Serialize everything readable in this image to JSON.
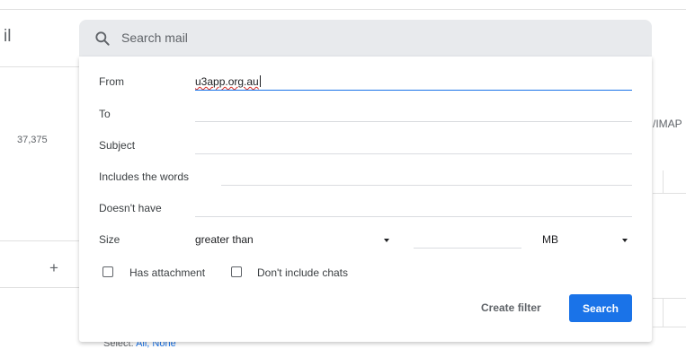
{
  "background": {
    "brand_fragment": "il",
    "mail_count": "37,375",
    "plus_glyph": "+",
    "right_fragment": "/IMAP",
    "bottom_prefix": "Select: ",
    "bottom_links": "All, None"
  },
  "search": {
    "placeholder": "Search mail",
    "icon": "search-icon"
  },
  "filter_form": {
    "from_label": "From",
    "from_value": "u3app.org.au",
    "to_label": "To",
    "subject_label": "Subject",
    "includes_label": "Includes the words",
    "doesnt_have_label": "Doesn't have",
    "size_label": "Size",
    "size_operator": "greater than",
    "size_unit": "MB",
    "has_attachment_label": "Has attachment",
    "has_attachment_checked": false,
    "dont_include_chats_label": "Don't include chats",
    "dont_include_chats_checked": false,
    "create_filter_label": "Create filter",
    "search_button_label": "Search"
  },
  "colors": {
    "accent": "#1a73e8",
    "searchbar_bg": "#e8eaed",
    "spellcheck": "#d93025"
  }
}
